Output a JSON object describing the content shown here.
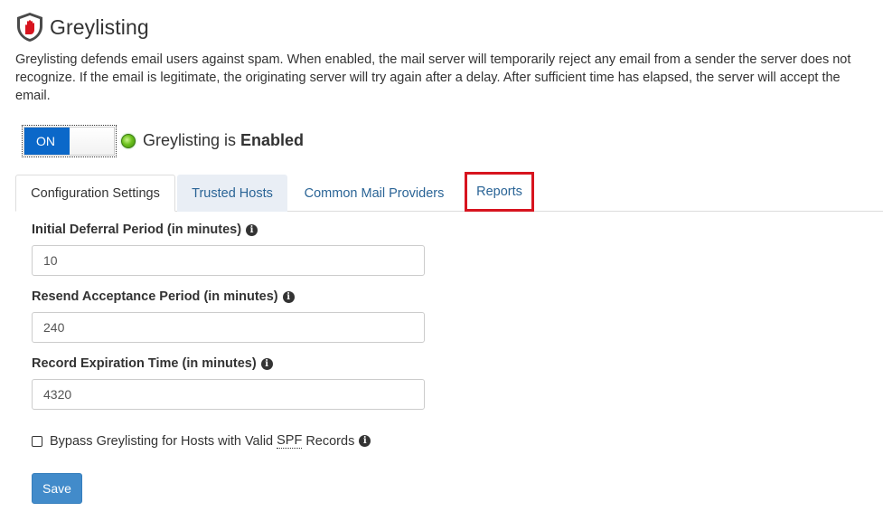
{
  "header": {
    "title": "Greylisting",
    "description": "Greylisting defends email users against spam. When enabled, the mail server will temporarily reject any email from a sender the server does not recognize. If the email is legitimate, the originating server will try again after a delay. After sufficient time has elapsed, the server will accept the email.",
    "icon": "shield-hand-icon"
  },
  "toggle": {
    "on_label": "ON",
    "state": "on"
  },
  "status": {
    "prefix": "Greylisting is ",
    "value": "Enabled",
    "led_color": "#6cc11e"
  },
  "tabs": [
    {
      "label": "Configuration Settings",
      "active": true
    },
    {
      "label": "Trusted Hosts",
      "active": false
    },
    {
      "label": "Common Mail Providers",
      "active": false
    },
    {
      "label": "Reports",
      "active": false,
      "highlighted": true,
      "highlight_color": "#d7141f"
    }
  ],
  "form": {
    "initial_deferral": {
      "label": "Initial Deferral Period (in minutes)",
      "value": "10"
    },
    "resend_acceptance": {
      "label": "Resend Acceptance Period (in minutes)",
      "value": "240"
    },
    "record_expiration": {
      "label": "Record Expiration Time (in minutes)",
      "value": "4320"
    },
    "bypass": {
      "prefix": "Bypass Greylisting for Hosts with Valid",
      "abbr": "SPF",
      "suffix": "Records",
      "checked": false
    },
    "save_label": "Save",
    "info_icon": "info-circle-icon"
  },
  "colors": {
    "accent": "#0b68c9",
    "link": "#2a6496",
    "save": "#428bca"
  }
}
